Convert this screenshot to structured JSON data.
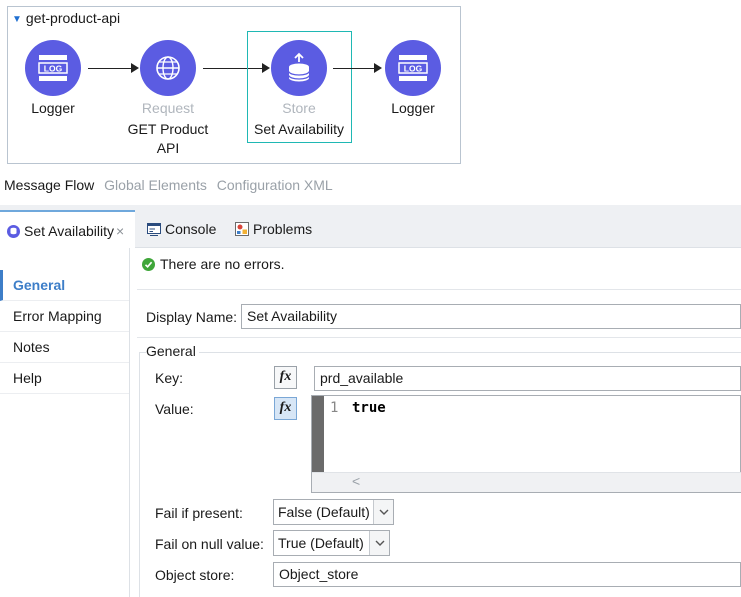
{
  "flow": {
    "name": "get-product-api",
    "nodes": [
      {
        "label": "Logger",
        "sublabel": "",
        "icon": "logger-icon"
      },
      {
        "label": "GET Product API",
        "label_line1": "GET Product",
        "label_line2": "API",
        "sublabel": "Request",
        "icon": "globe-icon"
      },
      {
        "label": "Set Availability",
        "sublabel": "Store",
        "icon": "store-icon"
      },
      {
        "label": "Logger",
        "sublabel": "",
        "icon": "logger-icon"
      }
    ],
    "logger_icon_text": "LOG"
  },
  "editor_tabs": [
    "Message Flow",
    "Global Elements",
    "Configuration XML"
  ],
  "panel": {
    "tabs": [
      {
        "label": "Set Availability",
        "icon": "store-icon"
      },
      {
        "label": "Console",
        "icon": "console-icon"
      },
      {
        "label": "Problems",
        "icon": "problems-icon"
      }
    ],
    "close_glyph": "×",
    "status": "There are no errors.",
    "nav": [
      "General",
      "Error Mapping",
      "Notes",
      "Help"
    ],
    "display_name": {
      "label": "Display Name:",
      "value": "Set Availability"
    },
    "group_title": "General",
    "fx": "fx",
    "key": {
      "label": "Key:",
      "value": "prd_available"
    },
    "value": {
      "label": "Value:",
      "line_number": "1",
      "code": "true"
    },
    "fail_if_present": {
      "label": "Fail if present:",
      "value": "False (Default)"
    },
    "fail_on_null": {
      "label": "Fail on null value:",
      "value": "True (Default)"
    },
    "object_store": {
      "label": "Object store:",
      "value": "Object_store"
    }
  },
  "colors": {
    "node": "#5b5ce2",
    "selection": "#1fb8b4",
    "accent": "#3d7ec8",
    "ok": "#3fa63a"
  }
}
